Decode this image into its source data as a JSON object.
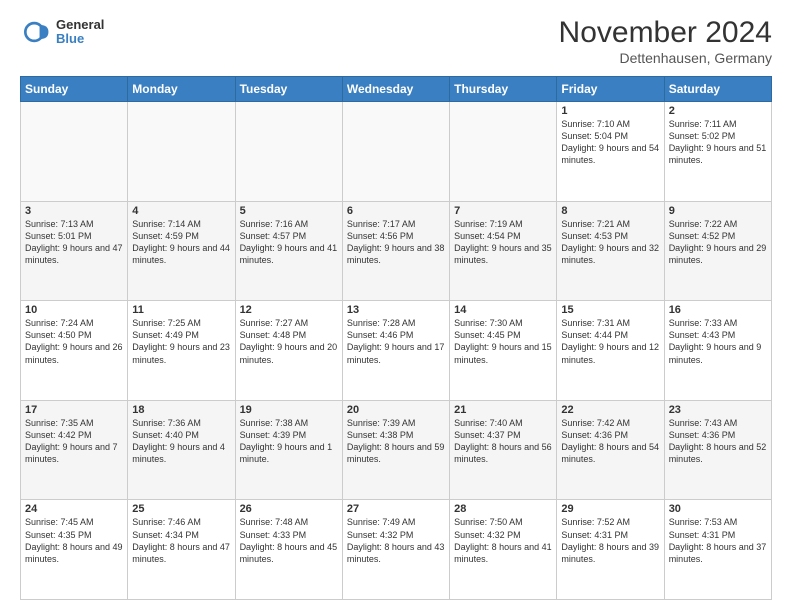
{
  "header": {
    "logo_general": "General",
    "logo_blue": "Blue",
    "month_title": "November 2024",
    "location": "Dettenhausen, Germany"
  },
  "columns": [
    "Sunday",
    "Monday",
    "Tuesday",
    "Wednesday",
    "Thursday",
    "Friday",
    "Saturday"
  ],
  "weeks": [
    {
      "rowClass": "row-odd",
      "days": [
        {
          "num": "",
          "info": "",
          "empty": true
        },
        {
          "num": "",
          "info": "",
          "empty": true
        },
        {
          "num": "",
          "info": "",
          "empty": true
        },
        {
          "num": "",
          "info": "",
          "empty": true
        },
        {
          "num": "",
          "info": "",
          "empty": true
        },
        {
          "num": "1",
          "info": "Sunrise: 7:10 AM\nSunset: 5:04 PM\nDaylight: 9 hours\nand 54 minutes."
        },
        {
          "num": "2",
          "info": "Sunrise: 7:11 AM\nSunset: 5:02 PM\nDaylight: 9 hours\nand 51 minutes."
        }
      ]
    },
    {
      "rowClass": "row-even",
      "days": [
        {
          "num": "3",
          "info": "Sunrise: 7:13 AM\nSunset: 5:01 PM\nDaylight: 9 hours\nand 47 minutes."
        },
        {
          "num": "4",
          "info": "Sunrise: 7:14 AM\nSunset: 4:59 PM\nDaylight: 9 hours\nand 44 minutes."
        },
        {
          "num": "5",
          "info": "Sunrise: 7:16 AM\nSunset: 4:57 PM\nDaylight: 9 hours\nand 41 minutes."
        },
        {
          "num": "6",
          "info": "Sunrise: 7:17 AM\nSunset: 4:56 PM\nDaylight: 9 hours\nand 38 minutes."
        },
        {
          "num": "7",
          "info": "Sunrise: 7:19 AM\nSunset: 4:54 PM\nDaylight: 9 hours\nand 35 minutes."
        },
        {
          "num": "8",
          "info": "Sunrise: 7:21 AM\nSunset: 4:53 PM\nDaylight: 9 hours\nand 32 minutes."
        },
        {
          "num": "9",
          "info": "Sunrise: 7:22 AM\nSunset: 4:52 PM\nDaylight: 9 hours\nand 29 minutes."
        }
      ]
    },
    {
      "rowClass": "row-odd",
      "days": [
        {
          "num": "10",
          "info": "Sunrise: 7:24 AM\nSunset: 4:50 PM\nDaylight: 9 hours\nand 26 minutes."
        },
        {
          "num": "11",
          "info": "Sunrise: 7:25 AM\nSunset: 4:49 PM\nDaylight: 9 hours\nand 23 minutes."
        },
        {
          "num": "12",
          "info": "Sunrise: 7:27 AM\nSunset: 4:48 PM\nDaylight: 9 hours\nand 20 minutes."
        },
        {
          "num": "13",
          "info": "Sunrise: 7:28 AM\nSunset: 4:46 PM\nDaylight: 9 hours\nand 17 minutes."
        },
        {
          "num": "14",
          "info": "Sunrise: 7:30 AM\nSunset: 4:45 PM\nDaylight: 9 hours\nand 15 minutes."
        },
        {
          "num": "15",
          "info": "Sunrise: 7:31 AM\nSunset: 4:44 PM\nDaylight: 9 hours\nand 12 minutes."
        },
        {
          "num": "16",
          "info": "Sunrise: 7:33 AM\nSunset: 4:43 PM\nDaylight: 9 hours\nand 9 minutes."
        }
      ]
    },
    {
      "rowClass": "row-even",
      "days": [
        {
          "num": "17",
          "info": "Sunrise: 7:35 AM\nSunset: 4:42 PM\nDaylight: 9 hours\nand 7 minutes."
        },
        {
          "num": "18",
          "info": "Sunrise: 7:36 AM\nSunset: 4:40 PM\nDaylight: 9 hours\nand 4 minutes."
        },
        {
          "num": "19",
          "info": "Sunrise: 7:38 AM\nSunset: 4:39 PM\nDaylight: 9 hours\nand 1 minute."
        },
        {
          "num": "20",
          "info": "Sunrise: 7:39 AM\nSunset: 4:38 PM\nDaylight: 8 hours\nand 59 minutes."
        },
        {
          "num": "21",
          "info": "Sunrise: 7:40 AM\nSunset: 4:37 PM\nDaylight: 8 hours\nand 56 minutes."
        },
        {
          "num": "22",
          "info": "Sunrise: 7:42 AM\nSunset: 4:36 PM\nDaylight: 8 hours\nand 54 minutes."
        },
        {
          "num": "23",
          "info": "Sunrise: 7:43 AM\nSunset: 4:36 PM\nDaylight: 8 hours\nand 52 minutes."
        }
      ]
    },
    {
      "rowClass": "row-odd",
      "days": [
        {
          "num": "24",
          "info": "Sunrise: 7:45 AM\nSunset: 4:35 PM\nDaylight: 8 hours\nand 49 minutes."
        },
        {
          "num": "25",
          "info": "Sunrise: 7:46 AM\nSunset: 4:34 PM\nDaylight: 8 hours\nand 47 minutes."
        },
        {
          "num": "26",
          "info": "Sunrise: 7:48 AM\nSunset: 4:33 PM\nDaylight: 8 hours\nand 45 minutes."
        },
        {
          "num": "27",
          "info": "Sunrise: 7:49 AM\nSunset: 4:32 PM\nDaylight: 8 hours\nand 43 minutes."
        },
        {
          "num": "28",
          "info": "Sunrise: 7:50 AM\nSunset: 4:32 PM\nDaylight: 8 hours\nand 41 minutes."
        },
        {
          "num": "29",
          "info": "Sunrise: 7:52 AM\nSunset: 4:31 PM\nDaylight: 8 hours\nand 39 minutes."
        },
        {
          "num": "30",
          "info": "Sunrise: 7:53 AM\nSunset: 4:31 PM\nDaylight: 8 hours\nand 37 minutes."
        }
      ]
    }
  ]
}
